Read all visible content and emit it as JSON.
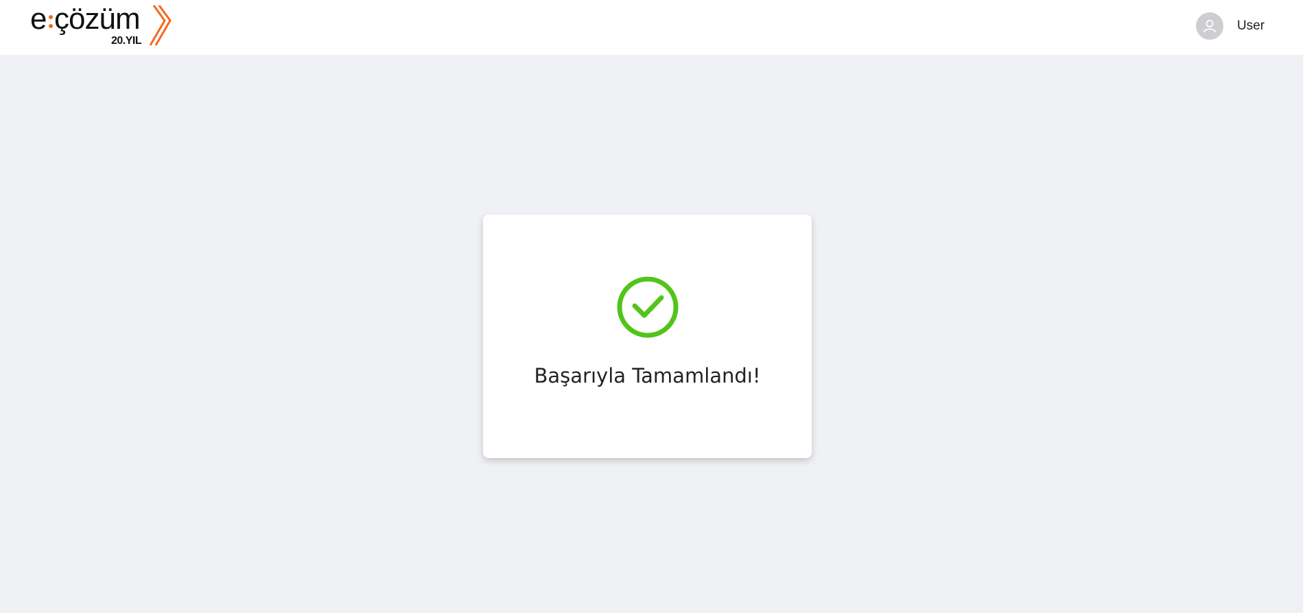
{
  "header": {
    "logo": {
      "wordmark": "e:çözüm",
      "badge": "20.YIL",
      "icon": "double-chevron-logo"
    },
    "user": {
      "avatar_icon": "user-icon",
      "name": "User"
    }
  },
  "result": {
    "status_icon": "check-circle-icon",
    "message": "Başarıyla Tamamlandı!"
  },
  "colors": {
    "background": "#eff1f5",
    "success": "#52c41a",
    "brand_accent": "#f26a1b"
  }
}
